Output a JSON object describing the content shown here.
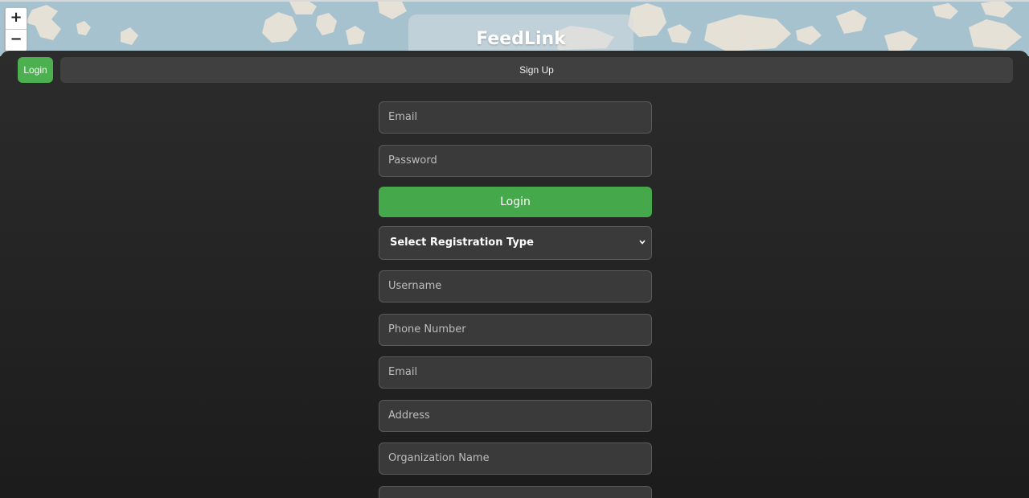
{
  "map": {
    "zoom_in": "+",
    "zoom_out": "−"
  },
  "brand": {
    "title": "FeedLink"
  },
  "tabs": {
    "login": "Login",
    "signup": "Sign Up"
  },
  "login_form": {
    "email_placeholder": "Email",
    "password_placeholder": "Password",
    "submit_label": "Login"
  },
  "signup_form": {
    "registration_type": "Select Registration Type",
    "username_placeholder": "Username",
    "phone_placeholder": "Phone Number",
    "email_placeholder": "Email",
    "address_placeholder": "Address",
    "organization_placeholder": "Organization Name"
  },
  "colors": {
    "accent": "#4caf50",
    "panel": "#2a2a2a",
    "field": "#3a3a3a",
    "water": "#a7c2cf",
    "land": "#e6e1d7"
  },
  "icons": [
    "zoom-in-icon",
    "zoom-out-icon",
    "chevron-down-icon"
  ]
}
